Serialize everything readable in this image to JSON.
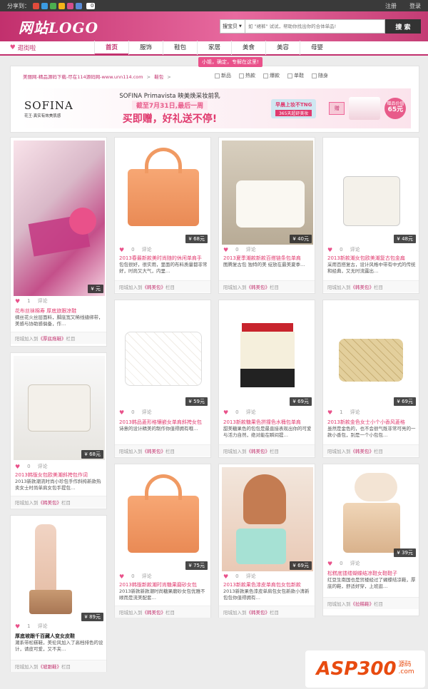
{
  "topbar": {
    "share_label": "分享到：",
    "share_count": "0",
    "login": "注册",
    "logout": "登录"
  },
  "header": {
    "logo": "网站LOGO"
  },
  "search": {
    "select": "搜宝贝",
    "placeholder": "如 \"裙裤\" 试试，帮助你找出你的合体单品!",
    "button": "搜 索"
  },
  "nav": {
    "home": "逛街啦",
    "items": [
      "首页",
      "服饰",
      "鞋包",
      "家居",
      "美食",
      "美容",
      "母婴"
    ],
    "tip": "小姐，确定，专解在这里!"
  },
  "breadcrumb": {
    "site": "美丽网-精品源码下载-尽在114源码网-www.unn114.com",
    "current": "鞋包"
  },
  "filters": [
    "新品",
    "热款",
    "爆款",
    "单鞋",
    "随身"
  ],
  "banner": {
    "brand": "SOFINA",
    "brand_sub": "花王·真实有效美肌感",
    "line1": "SOFINA Primavista 映美焕采妆前乳",
    "line2": "截至7月31日,最后一周",
    "line3": "买即赠，好礼送不停!",
    "tag1": "早晨上妆不TNG",
    "tag2": "365天超舒美妆",
    "gift": "赠",
    "price_label": "赠品价值",
    "price": "65元"
  },
  "cards": [
    {
      "price": "¥ 元",
      "likes": "1",
      "comment": "评论",
      "title": "花布丝袜棉寿 厚底旅跟凉鞋",
      "desc": "绸丝花火丝层面料，脚底宽又稀线缝绑带，美感与协助感俱备，作…",
      "foot_prefix": "阳城加入到",
      "foot_link": "《厚底拖鞋》",
      "foot_suffix": "栏目"
    },
    {
      "price": "¥ 68元",
      "likes": "0",
      "comment": "评论",
      "title": "2013春最新款美时尚随的休闲单肩手",
      "desc": "包包很好，很实用，里面的布料质量都非常好，时尚又大气，内里…",
      "foot_prefix": "阳城加入到",
      "foot_link": "《韩美包》",
      "foot_suffix": "栏目"
    },
    {
      "price": "¥ 40元",
      "likes": "0",
      "comment": "评论",
      "title": "2013夏季潮款新款百搭链条包单肩",
      "desc": "图腾复古包 独特的美 绽放在最美夏季…",
      "foot_prefix": "阳城加入到",
      "foot_link": "《韩美包》",
      "foot_suffix": "栏目"
    },
    {
      "price": "¥ 48元",
      "likes": "0",
      "comment": "评论",
      "title": "2013新款潮女包欧美潮复古包金扁",
      "desc": "采用百搭复古，设计风格中带有中式的传统和经典，又无时流露出…",
      "foot_prefix": "阳城加入到",
      "foot_link": "《韩美包》",
      "foot_suffix": "栏目"
    },
    {
      "price": "¥ 68元",
      "likes": "0",
      "comment": "评论",
      "title": "2013韩版女包欧美潮斜挎包作词",
      "desc": "2013新款潮流时尚小珍包手作斜挎新款热卖女士时尚单肩女包手提包…",
      "foot_prefix": "阳城加入到",
      "foot_link": "《韩美包》",
      "foot_suffix": "栏目"
    },
    {
      "price": "¥ 59元",
      "likes": "0",
      "comment": "评论",
      "title": "2013韩品菱形格镶嵌女单肩斜挎女包",
      "desc": "诗意的设计精美的制作你值得拥有哦…",
      "foot_prefix": "阳城加入到",
      "foot_link": "《韩美包》",
      "foot_suffix": "栏目"
    },
    {
      "price": "¥ 69元",
      "likes": "0",
      "comment": "评论",
      "title": "2013新款糖果色拼撞色水桶包单肩",
      "desc": "甜美糖果色的包包是最直接表现出你的可爱与活力自然，绝对能在瞬间提…",
      "foot_prefix": "阳城加入到",
      "foot_link": "《韩美包》",
      "foot_suffix": "栏目"
    },
    {
      "price": "¥ 69元",
      "likes": "1",
      "comment": "评论",
      "title": "2013新款金色女士小个小香风菱格",
      "desc": "虽然是金色的，也不会很气既非常可亮的一款小香包，别是一个小包包…",
      "foot_prefix": "阳城加入到",
      "foot_link": "《韩美包》",
      "foot_suffix": "栏目"
    },
    {
      "price": "¥ 75元",
      "likes": "0",
      "comment": "评论",
      "title": "2013韩版新款潮时尚糖果磨砂女包",
      "desc": "2013新款新款潮时尚糖果磨砂女包优雅不顺而是流美配套…",
      "foot_prefix": "阳城加入到",
      "foot_link": "《韩美包》",
      "foot_suffix": "栏目"
    },
    {
      "price": "¥ 69元",
      "likes": "0",
      "comment": "评论",
      "title": "2013新款果色漆皮单肩包女包新款",
      "desc": "2013新款果色漆皮单肩包女包新款小清新包包你值得拥有…",
      "foot_prefix": "阳城加入到",
      "foot_link": "《韩美包》",
      "foot_suffix": "栏目"
    },
    {
      "price": "¥ 89元",
      "likes": "1",
      "comment": "评论",
      "title": "厚底坡跟千百藏人变女皮鞋",
      "desc": "潮系带松糕鞋，美伦风加入了高档排色的设计，请皮可爱，又不夹…",
      "foot_prefix": "阳城加入到",
      "foot_link": "《坡跟鞋》",
      "foot_suffix": "栏目"
    },
    {
      "price": "¥ 39元",
      "likes": "0",
      "comment": "评论",
      "title": "松糕底镂缕蝴蝶结凉鞋女鞋鞋子",
      "desc": "红豆生南国也是贸楼经过了蝴蝶结凉鞋，厚底的鞋，舒适好穿，上班逛…",
      "foot_prefix": "阳城加入到",
      "foot_link": "《拉糕鞋》",
      "foot_suffix": "栏目"
    }
  ],
  "watermark": {
    "text1": "ASP",
    "text2": "300",
    "tail1": "源码",
    "tail2": ".com"
  }
}
